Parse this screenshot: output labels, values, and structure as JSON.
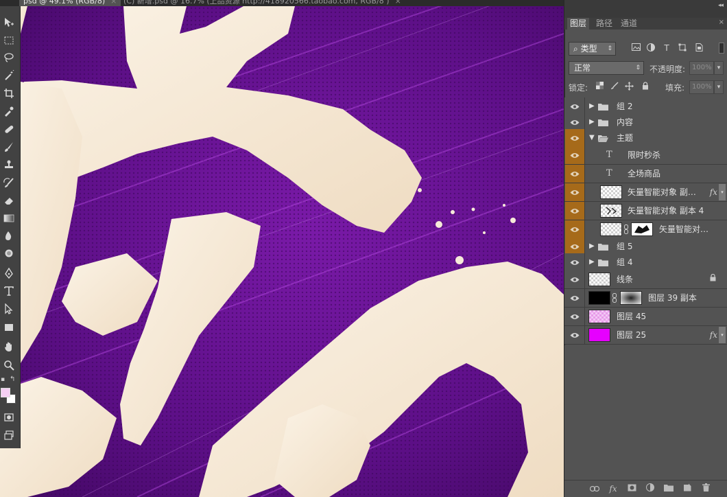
{
  "doc_tabs": [
    {
      "label": "psd @ 49.1% (RGB/8)",
      "close": "×",
      "active": true
    },
    {
      "label": "(C) 新增.psd @ 16.7% (上品资源 http://418920566.taobao.com, RGB/8 )",
      "close": "×",
      "active": false
    }
  ],
  "panel": {
    "tabs": [
      "图层",
      "路径",
      "通道"
    ],
    "collapse": "◂◂",
    "close": "×",
    "menu": "≡",
    "filter": {
      "label": "类型",
      "search_glyph": "⌕",
      "arrow": "⇕",
      "icons": [
        "image-filter-icon",
        "adjustment-filter-icon",
        "text-filter-icon",
        "shape-filter-icon",
        "smart-object-filter-icon"
      ]
    },
    "blend_mode": "正常",
    "blend_arrow": "⇕",
    "opacity_label": "不透明度:",
    "opacity_value": "100%",
    "lock_label": "锁定:",
    "fill_label": "填充:",
    "fill_value": "100%",
    "spin_arrow": "▾"
  },
  "layers": [
    {
      "name": "组 2",
      "type": "group",
      "expanded": false,
      "indent": 0,
      "selected": false
    },
    {
      "name": "内容",
      "type": "group",
      "expanded": false,
      "indent": 0,
      "selected": false
    },
    {
      "name": "主题",
      "type": "group",
      "expanded": true,
      "indent": 0,
      "selected": true
    },
    {
      "name": "限时秒杀",
      "type": "text",
      "indent": 1,
      "selected": true
    },
    {
      "name": "全场商品",
      "type": "text",
      "indent": 1,
      "selected": true
    },
    {
      "name": "矢量智能对象 副…",
      "type": "smart",
      "indent": 1,
      "selected": true,
      "fx": true
    },
    {
      "name": "矢量智能对象 副本 4",
      "type": "smart",
      "indent": 1,
      "selected": true
    },
    {
      "name": "矢量智能对…",
      "type": "smart-mask",
      "indent": 1,
      "selected": true
    },
    {
      "name": "组 5",
      "type": "group",
      "expanded": false,
      "indent": 0,
      "selected": true
    },
    {
      "name": "组 4",
      "type": "group",
      "expanded": false,
      "indent": 0,
      "selected": false
    },
    {
      "name": "线条",
      "type": "pixel",
      "indent": 0,
      "selected": false,
      "locked": true
    },
    {
      "name": "图层 39 副本",
      "type": "pixel-mask",
      "indent": 0,
      "selected": false
    },
    {
      "name": "图层 45",
      "type": "pixel-pink",
      "indent": 0,
      "selected": false
    },
    {
      "name": "图层 25",
      "type": "pixel-magenta",
      "indent": 0,
      "selected": false,
      "fx": true
    }
  ],
  "glyphs": {
    "fx": "fx",
    "lock": "🔒",
    "text_layer": "T",
    "chain": "⛓",
    "expanded": "▼",
    "collapsed": "▶"
  },
  "colors": {
    "canvas_purple": "#5a0c82",
    "brush_cream": "#f6ead9",
    "selected_eye": "#a66a1a",
    "foreground": "#f5cff3",
    "background": "#ffffff",
    "magenta_fill": "#e600ff"
  },
  "footer_icons": [
    "link-layers-icon",
    "layer-style-icon",
    "add-mask-icon",
    "adjustment-layer-icon",
    "new-group-icon",
    "new-layer-icon",
    "delete-layer-icon"
  ]
}
